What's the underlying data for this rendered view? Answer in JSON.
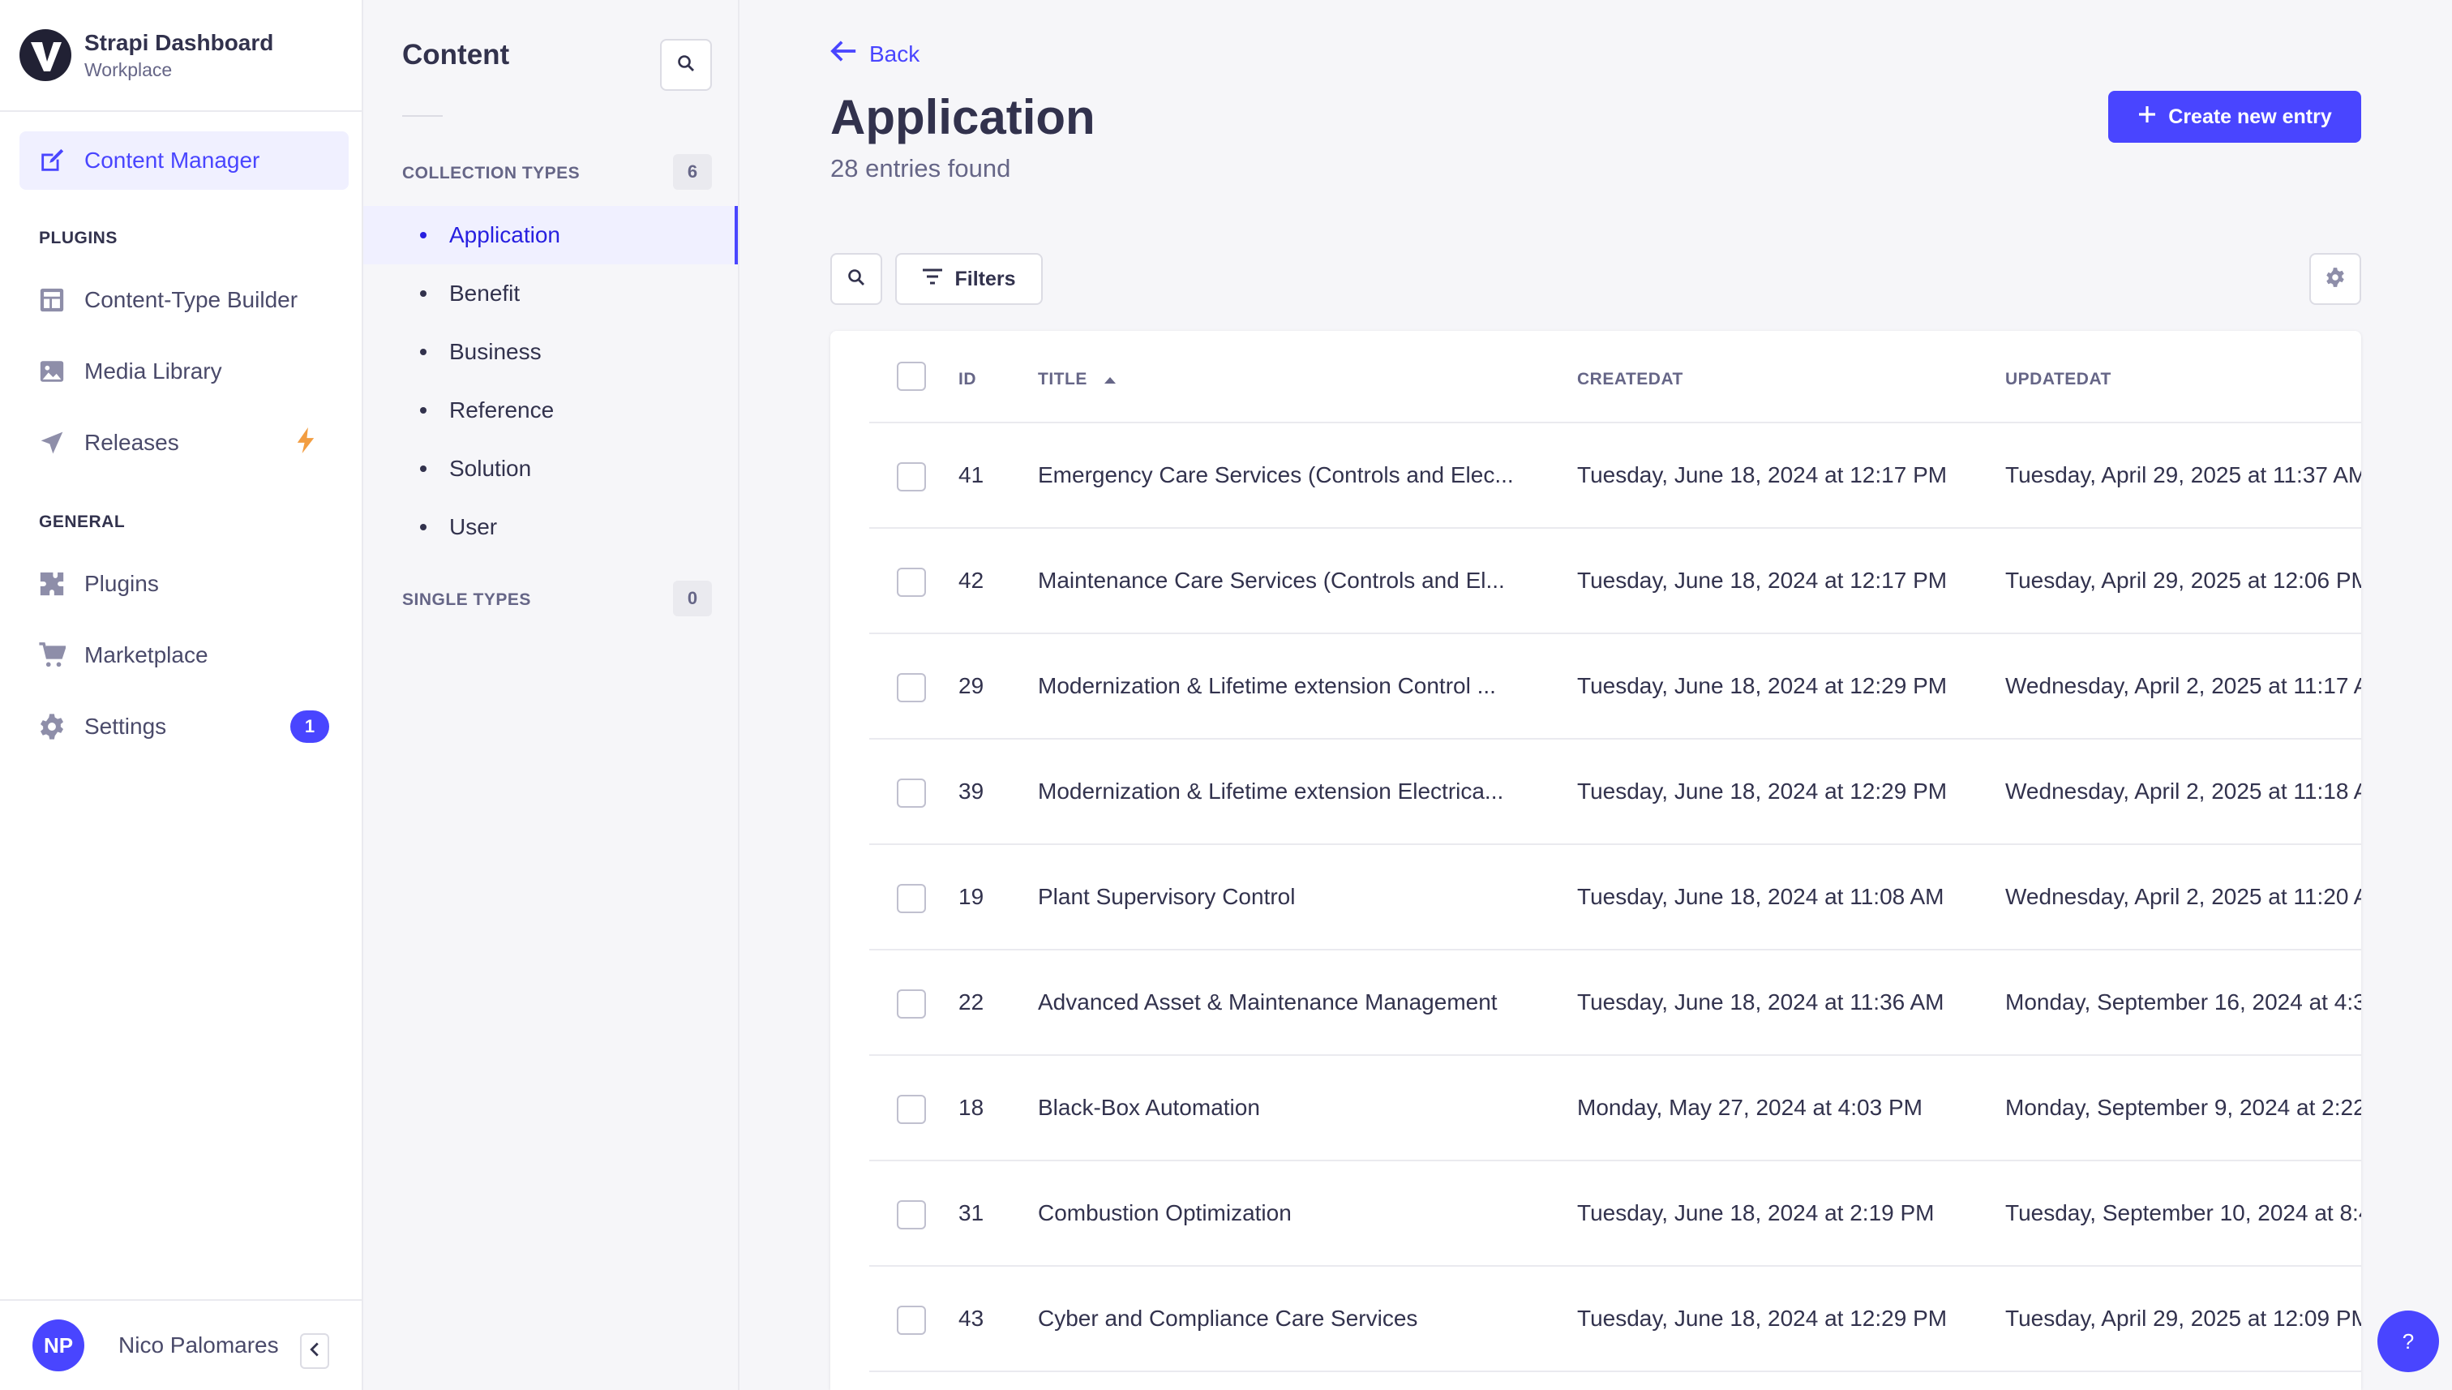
{
  "brand": {
    "title": "Strapi Dashboard",
    "subtitle": "Workplace"
  },
  "mainnav": {
    "content_manager": "Content Manager",
    "plugins_section": "PLUGINS",
    "content_type_builder": "Content-Type Builder",
    "media_library": "Media Library",
    "releases": "Releases",
    "general_section": "GENERAL",
    "plugins": "Plugins",
    "marketplace": "Marketplace",
    "settings": "Settings",
    "settings_badge": "1"
  },
  "user": {
    "initials": "NP",
    "name": "Nico Palomares"
  },
  "subnav": {
    "title": "Content",
    "collection_types_label": "COLLECTION TYPES",
    "collection_types_count": "6",
    "collection_types": [
      "Application",
      "Benefit",
      "Business",
      "Reference",
      "Solution",
      "User"
    ],
    "active_item": "Application",
    "single_types_label": "SINGLE TYPES",
    "single_types_count": "0"
  },
  "page": {
    "back_label": "Back",
    "title": "Application",
    "subtitle": "28 entries found",
    "create_label": "Create new entry",
    "filters_label": "Filters"
  },
  "table": {
    "headers": {
      "id": "ID",
      "title": "TITLE",
      "createdat": "CREATEDAT",
      "updatedat": "UPDATEDAT"
    },
    "sort": {
      "column": "TITLE",
      "direction": "ascending"
    },
    "rows": [
      {
        "id": "41",
        "title": "Emergency Care Services (Controls and Elec...",
        "createdAt": "Tuesday, June 18, 2024 at 12:17 PM",
        "updatedAt": "Tuesday, April 29, 2025 at 11:37 AM"
      },
      {
        "id": "42",
        "title": "Maintenance Care Services (Controls and El...",
        "createdAt": "Tuesday, June 18, 2024 at 12:17 PM",
        "updatedAt": "Tuesday, April 29, 2025 at 12:06 PM"
      },
      {
        "id": "29",
        "title": "Modernization & Lifetime extension Control ...",
        "createdAt": "Tuesday, June 18, 2024 at 12:29 PM",
        "updatedAt": "Wednesday, April 2, 2025 at 11:17 A"
      },
      {
        "id": "39",
        "title": "Modernization & Lifetime extension Electrica...",
        "createdAt": "Tuesday, June 18, 2024 at 12:29 PM",
        "updatedAt": "Wednesday, April 2, 2025 at 11:18 A"
      },
      {
        "id": "19",
        "title": "Plant Supervisory Control",
        "createdAt": "Tuesday, June 18, 2024 at 11:08 AM",
        "updatedAt": "Wednesday, April 2, 2025 at 11:20 A"
      },
      {
        "id": "22",
        "title": "Advanced Asset & Maintenance Management",
        "createdAt": "Tuesday, June 18, 2024 at 11:36 AM",
        "updatedAt": "Monday, September 16, 2024 at 4:3"
      },
      {
        "id": "18",
        "title": "Black-Box Automation",
        "createdAt": "Monday, May 27, 2024 at 4:03 PM",
        "updatedAt": "Monday, September 9, 2024 at 2:22"
      },
      {
        "id": "31",
        "title": "Combustion Optimization",
        "createdAt": "Tuesday, June 18, 2024 at 2:19 PM",
        "updatedAt": "Tuesday, September 10, 2024 at 8:4"
      },
      {
        "id": "43",
        "title": "Cyber and Compliance Care Services",
        "createdAt": "Tuesday, June 18, 2024 at 12:29 PM",
        "updatedAt": "Tuesday, April 29, 2025 at 12:09 PM"
      }
    ]
  },
  "help_label": "?",
  "colors": {
    "primary": "#4945ff",
    "primary_light": "#f0f0ff",
    "text": "#32324d",
    "muted": "#666687",
    "bolt": "#f29d41"
  },
  "icons": [
    "content-manager-icon",
    "content-type-builder-icon",
    "media-library-icon",
    "releases-icon",
    "bolt-icon",
    "plugins-icon",
    "marketplace-icon",
    "settings-icon",
    "search-icon",
    "back-arrow-icon",
    "plus-icon",
    "filter-icon",
    "gear-icon",
    "sort-up-icon",
    "chevron-left-icon"
  ]
}
